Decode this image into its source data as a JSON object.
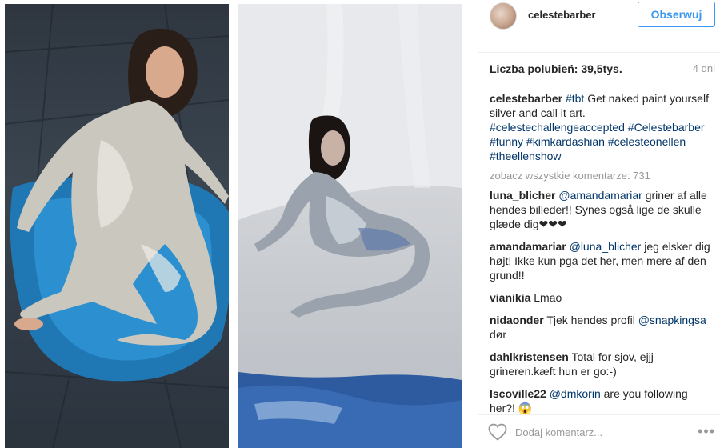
{
  "post": {
    "username": "celestebarber",
    "follow_label": "Obserwuj",
    "likes": "Liczba polubień: 39,5tys.",
    "time": "4 dni",
    "caption": {
      "user": "celestebarber",
      "hashtags_line1": "#tbt",
      "text": " Get naked paint yourself silver and call it art. ",
      "hashtags": "#celestechallengeaccepted #Celestebarber #funny #kimkardashian #celesteonellen #theellenshow"
    },
    "view_all": "zobacz wszystkie komentarze: 731",
    "comments": [
      {
        "user": "luna_blicher",
        "mention": "@amandamariar",
        "text": " griner af alle hendes billeder!! Synes også lige de skulle glæde dig❤❤❤"
      },
      {
        "user": "amandamariar",
        "mention": "@luna_blicher",
        "text": " jeg elsker dig højt! Ikke kun pga det her, men mere af den grund!!"
      },
      {
        "user": "vianikia",
        "mention": "",
        "text": "Lmao"
      },
      {
        "user": "nidaonder",
        "mention": "",
        "text": "Tjek hendes profil ",
        "mention_after": "@snapkingsa",
        "text_after": " dør"
      },
      {
        "user": "dahlkristensen",
        "mention": "",
        "text": "Total for sjov, ejjj grineren.kæft hun er go:-)"
      },
      {
        "user": "lscoville22",
        "mention": "@dmkorin",
        "text": " are you following her?! 😱"
      }
    ],
    "comment_placeholder": "Dodaj komentarz...",
    "more_label": "•••"
  },
  "icons": {
    "heart": "heart-icon",
    "more": "more-options-icon",
    "avatar": "avatar"
  },
  "colors": {
    "follow_blue": "#3897f0",
    "link": "#003569",
    "muted": "#999999"
  }
}
